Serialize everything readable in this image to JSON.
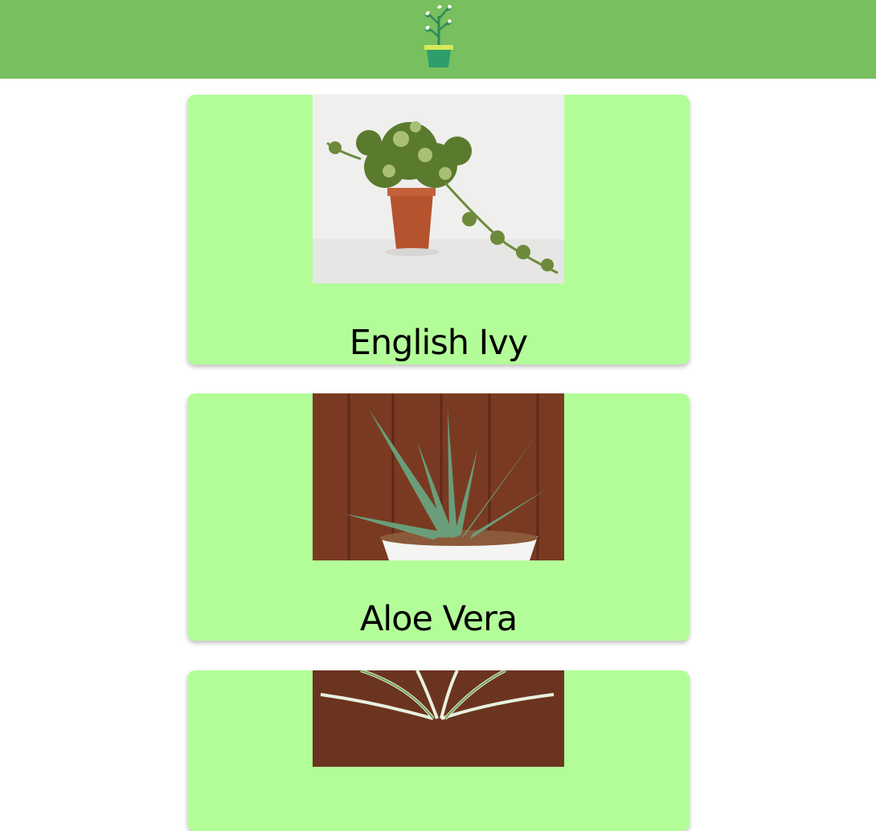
{
  "header": {
    "logo_icon": "potted-plant-icon",
    "background_color": "#77bf5f"
  },
  "colors": {
    "card_background": "#b3fd99",
    "page_background": "#ffffff"
  },
  "plants": [
    {
      "name": "English Ivy",
      "image": "english-ivy-photo"
    },
    {
      "name": "Aloe Vera",
      "image": "aloe-vera-photo"
    },
    {
      "name": "",
      "image": "spider-plant-photo"
    }
  ]
}
